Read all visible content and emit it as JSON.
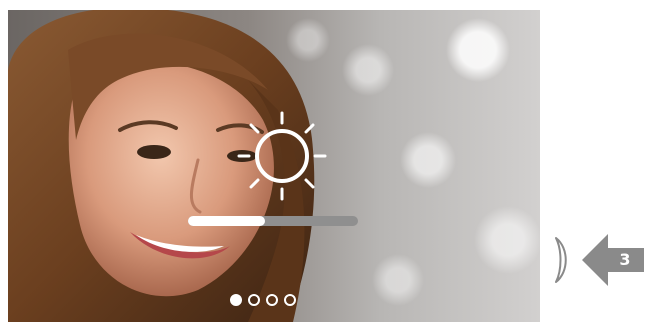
{
  "screen": {
    "photo_subject": "smiling-woman-portrait"
  },
  "brightness": {
    "icon": "sun-icon",
    "level": 0.45
  },
  "pagination": {
    "total": 4,
    "active_index": 0
  },
  "callout": {
    "number": "3",
    "arrow_color": "#8a8a8a",
    "bracket_color": "#8a8a8a"
  }
}
